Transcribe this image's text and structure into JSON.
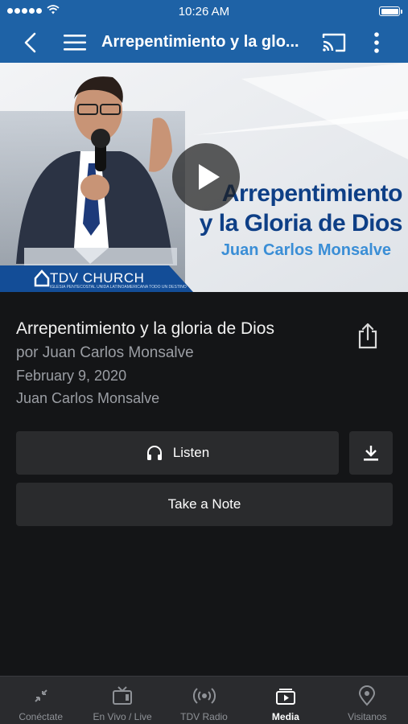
{
  "status": {
    "time": "10:26 AM"
  },
  "nav": {
    "title": "Arrepentimiento y la glo..."
  },
  "hero": {
    "title_line1": "Arrepentimiento",
    "title_line2": "y la Gloria de Dios",
    "subtitle": "Juan Carlos Monsalve",
    "logo_text": "TDV CHURCH",
    "logo_small": "IGLESIA PENTECOSTAL UNIDA LATINOAMERICANA TODO UN DESTINO"
  },
  "details": {
    "title": "Arrepentimiento y la gloria de Dios",
    "by": "por Juan Carlos Monsalve",
    "date": "February 9, 2020",
    "speaker": "Juan Carlos Monsalve"
  },
  "actions": {
    "listen": "Listen",
    "note": "Take a Note"
  },
  "tabs": [
    {
      "label": "Conéctate",
      "icon": "connect-icon"
    },
    {
      "label": "En Vivo / Live",
      "icon": "tv-icon"
    },
    {
      "label": "TDV Radio",
      "icon": "radio-broadcast-icon"
    },
    {
      "label": "Media",
      "icon": "media-play-icon",
      "active": true
    },
    {
      "label": "Visitanos",
      "icon": "location-pin-icon"
    }
  ],
  "colors": {
    "nav_bg": "#1e62a6",
    "background": "#141517",
    "button_bg": "#2a2b2d",
    "tabbar_bg": "#2a2b2e",
    "hero_title": "#0e3f86",
    "hero_subtitle": "#3a8ed6"
  }
}
